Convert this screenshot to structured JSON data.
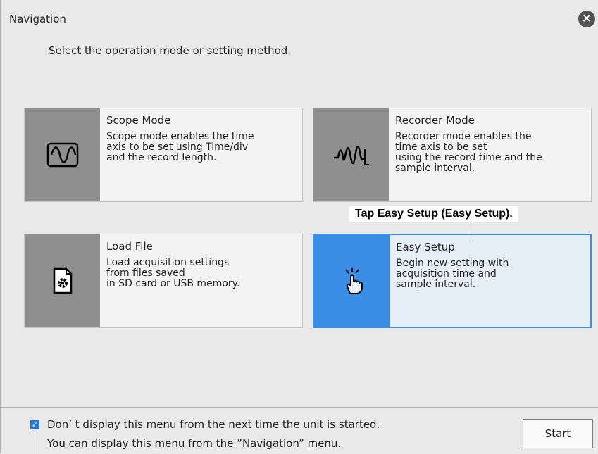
{
  "window": {
    "title": "Navigation",
    "close_icon": "close-icon",
    "prompt": "Select the operation mode or setting method."
  },
  "cards": [
    {
      "title": "Scope Mode",
      "description": "Scope mode enables the time\naxis to be set using Time/div\nand the record length.",
      "icon": "sine-wave-icon",
      "selected": false
    },
    {
      "title": "Recorder Mode",
      "description": "Recorder mode enables the\ntime axis to be set\nusing the record time and the\nsample interval.",
      "icon": "waveform-recorder-icon",
      "selected": false
    },
    {
      "title": "Load File",
      "description": "Load acquisition settings\nfrom files saved\nin SD card or USB memory.",
      "icon": "settings-file-icon",
      "selected": false
    },
    {
      "title": "Easy Setup",
      "description": "Begin new setting with\nacquisition time and\nsample interval.",
      "icon": "tap-hand-icon",
      "selected": true
    }
  ],
  "annotation": {
    "text": "Tap Easy Setup (Easy Setup)."
  },
  "footer": {
    "checkbox_checked": true,
    "checkbox_label": "Don’ t display this menu from the next time the unit is started.",
    "hint": "You can display this menu from the  ”Navigation” menu.",
    "start_label": "Start"
  },
  "colors": {
    "selected_accent": "#3a8ee6",
    "icon_panel": "#8f8f8f",
    "background": "#e9e9e9"
  }
}
